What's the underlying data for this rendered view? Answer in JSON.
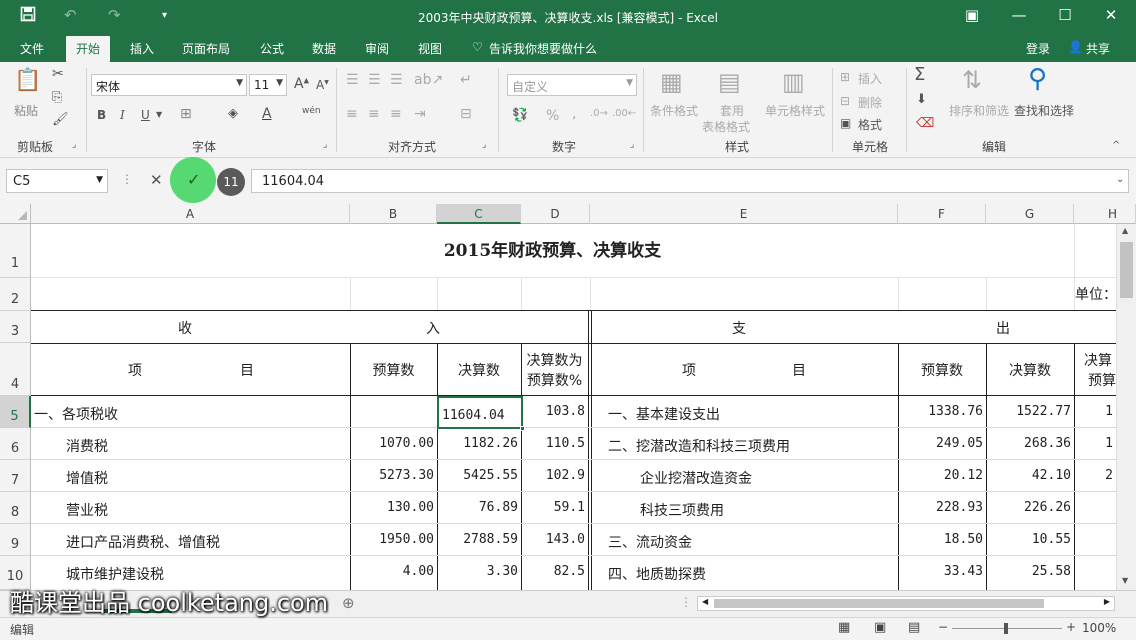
{
  "window": {
    "title": "2003年中央财政预算、决算收支.xls  [兼容模式] - Excel",
    "save_icon": "save-icon",
    "undo_icon": "undo-icon",
    "redo_icon": "redo-icon"
  },
  "menu": {
    "items": [
      "文件",
      "开始",
      "插入",
      "页面布局",
      "公式",
      "数据",
      "审阅",
      "视图"
    ],
    "active": "开始",
    "tellme": "告诉我你想要做什么",
    "login": "登录",
    "share": "共享"
  },
  "ribbon": {
    "clipboard": {
      "paste": "粘贴",
      "label": "剪贴板"
    },
    "font": {
      "name": "宋体",
      "size": "11",
      "label": "字体",
      "bold": "B",
      "italic": "I",
      "underline": "U",
      "grow": "A",
      "shrink": "A",
      "color_a": "A",
      "wen": "wén"
    },
    "align": {
      "label": "对齐方式"
    },
    "number": {
      "format": "自定义",
      "label": "数字",
      "percent": "%",
      "comma": ","
    },
    "styles": {
      "cond": "条件格式",
      "table1": "套用",
      "table2": "表格格式",
      "cell": "单元格样式",
      "label": "样式"
    },
    "cells": {
      "insert": "插入",
      "delete": "删除",
      "format": "格式",
      "label": "单元格"
    },
    "editing": {
      "sortfilter": "排序和筛选",
      "find": "查找和选择",
      "label": "编辑",
      "sigma": "Σ"
    }
  },
  "formula_bar": {
    "name_box": "C5",
    "cancel": "✕",
    "enter": "✓",
    "badge": "11",
    "content": "11604.04"
  },
  "columns": [
    "A",
    "B",
    "C",
    "D",
    "E",
    "F",
    "G",
    "H"
  ],
  "rows": [
    "1",
    "2",
    "3",
    "4",
    "5",
    "6",
    "7",
    "8",
    "9",
    "10"
  ],
  "sheet": {
    "title": "2015年财政预算、决算收支",
    "unit": "单位：",
    "income_l": "收",
    "income_r": "入",
    "expense_l": "支",
    "expense_r": "出",
    "h_item1": "项",
    "h_item2": "目",
    "h_budget": "预算数",
    "h_final": "决算数",
    "h_pct1": "决算数为",
    "h_pct2": "预算数%",
    "h_pct_r1": "决算",
    "h_pct_r2": "预算",
    "data_rows": [
      {
        "a": "一、各项税收",
        "b": "",
        "c": "11604.04",
        "d": "103.8",
        "e": "一、基本建设支出",
        "f": "1338.76",
        "g": "1522.77",
        "h": "1"
      },
      {
        "a": "消费税",
        "b": "1070.00",
        "c": "1182.26",
        "d": "110.5",
        "e": "二、挖潜改造和科技三项费用",
        "f": "249.05",
        "g": "268.36",
        "h": "1"
      },
      {
        "a": "增值税",
        "b": "5273.30",
        "c": "5425.55",
        "d": "102.9",
        "e": "企业挖潜改造资金",
        "f": "20.12",
        "g": "42.10",
        "h": "2"
      },
      {
        "a": "营业税",
        "b": "130.00",
        "c": "76.89",
        "d": "59.1",
        "e": "科技三项费用",
        "f": "228.93",
        "g": "226.26",
        "h": ""
      },
      {
        "a": "进口产品消费税、增值税",
        "b": "1950.00",
        "c": "2788.59",
        "d": "143.0",
        "e": "三、流动资金",
        "f": "18.50",
        "g": "10.55",
        "h": ""
      },
      {
        "a": "城市维护建设税",
        "b": "4.00",
        "c": "3.30",
        "d": "82.5",
        "e": "四、地质勘探费",
        "f": "33.43",
        "g": "25.58",
        "h": ""
      }
    ]
  },
  "status": {
    "mode": "编辑",
    "zoom": "100%"
  },
  "watermark": "酷课堂出品 coolketang.com"
}
